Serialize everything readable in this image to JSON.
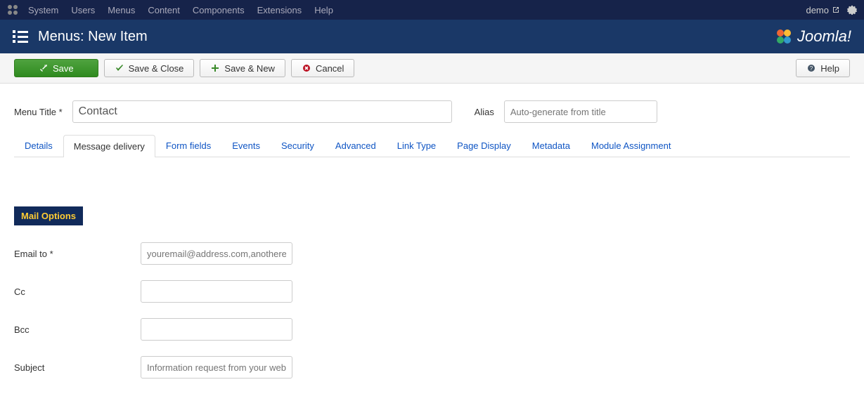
{
  "topbar": {
    "menu": [
      "System",
      "Users",
      "Menus",
      "Content",
      "Components",
      "Extensions",
      "Help"
    ],
    "user": "demo"
  },
  "header": {
    "title": "Menus: New Item",
    "brand": "Joomla!"
  },
  "toolbar": {
    "save": "Save",
    "save_close": "Save & Close",
    "save_new": "Save & New",
    "cancel": "Cancel",
    "help": "Help"
  },
  "form": {
    "menu_title_label": "Menu Title *",
    "menu_title_value": "Contact",
    "alias_label": "Alias",
    "alias_placeholder": "Auto-generate from title"
  },
  "tabs": [
    "Details",
    "Message delivery",
    "Form fields",
    "Events",
    "Security",
    "Advanced",
    "Link Type",
    "Page Display",
    "Metadata",
    "Module Assignment"
  ],
  "active_tab": 1,
  "mail": {
    "section_title": "Mail Options",
    "email_to_label": "Email to *",
    "email_to_placeholder": "youremail@address.com,anotheremail@address.com",
    "cc_label": "Cc",
    "cc_value": "",
    "bcc_label": "Bcc",
    "bcc_value": "",
    "subject_label": "Subject",
    "subject_placeholder": "Information request from your website"
  }
}
